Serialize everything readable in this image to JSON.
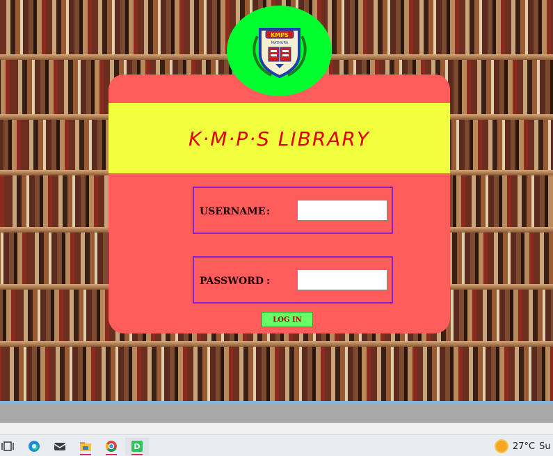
{
  "app": {
    "title": "K·M·P·S LIBRARY",
    "logo": {
      "text": "KMPS",
      "subtext": "MATHURA",
      "colors": {
        "circle": "#00ff2e",
        "shield_border": "#1f3ea8",
        "shield_fill": "#f5f0d0"
      }
    }
  },
  "form": {
    "username": {
      "label": "USERNAME",
      "separator": ":",
      "value": "",
      "placeholder": ""
    },
    "password": {
      "label": "PASSWORD",
      "separator": ":",
      "value": "",
      "placeholder": ""
    },
    "login_label": "LOG IN"
  },
  "colors": {
    "card": "#ff5c5c",
    "banner": "#f2ff3c",
    "title_text": "#e00000",
    "field_border": "#8a1fd0",
    "button": "#66ff66"
  },
  "taskbar": {
    "icons": [
      "task-view-icon",
      "edge-icon",
      "mail-icon",
      "file-explorer-icon",
      "chrome-icon",
      "app-d-icon"
    ],
    "app_d_letter": "D",
    "weather": {
      "temperature": "27°C",
      "trail": "Su"
    }
  }
}
